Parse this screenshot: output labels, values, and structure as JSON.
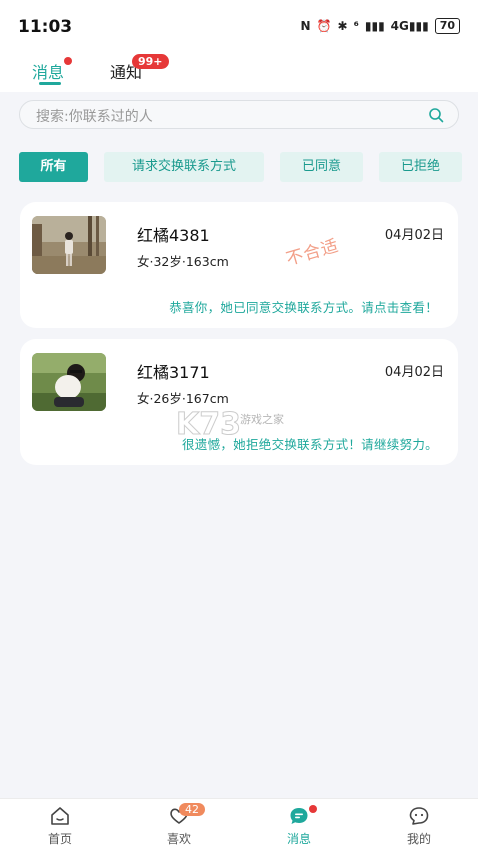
{
  "status_bar": {
    "time": "11:03",
    "nfc": "N",
    "alarm": "⏰",
    "bluetooth": "✱",
    "wifi": "⁶",
    "signal1": "▮▮▮",
    "signal2": "4G▮▮▮",
    "battery": "70"
  },
  "tabs": {
    "messages": "消息",
    "notices": "通知",
    "notices_badge": "99+"
  },
  "search": {
    "placeholder": "搜索:你联系过的人"
  },
  "filters": [
    "所有",
    "请求交换联系方式",
    "已同意",
    "已拒绝"
  ],
  "cards": [
    {
      "name": "红橘4381",
      "info": "女·32岁·163cm",
      "date": "04月02日",
      "status": "恭喜你，她已同意交换联系方式。请点击查看！",
      "stamp": "不合适"
    },
    {
      "name": "红橘3171",
      "info": "女·26岁·167cm",
      "date": "04月02日",
      "status": "很遗憾，她拒绝交换联系方式！请继续努力。"
    }
  ],
  "watermark": {
    "big": "K73",
    "small": "游戏之家"
  },
  "bottom_nav": [
    {
      "label": "首页",
      "icon": "home-icon"
    },
    {
      "label": "喜欢",
      "icon": "heart-icon",
      "badge": "42"
    },
    {
      "label": "消息",
      "icon": "chat-icon"
    },
    {
      "label": "我的",
      "icon": "profile-icon"
    }
  ],
  "colors": {
    "accent": "#1fa89c",
    "badge_red": "#e63838",
    "stamp": "#f29a82"
  }
}
